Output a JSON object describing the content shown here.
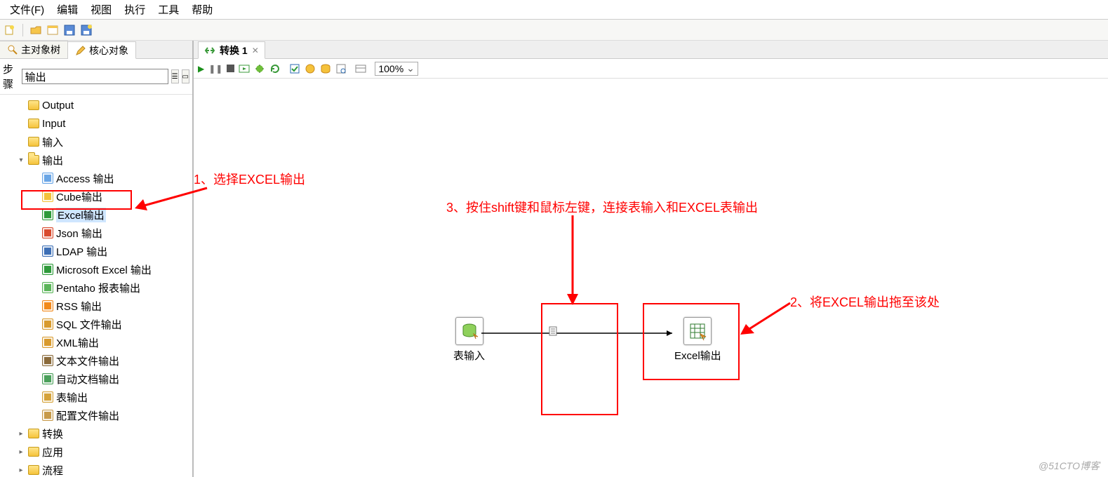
{
  "menu": {
    "file": "文件(F)",
    "edit": "编辑",
    "view": "视图",
    "run": "执行",
    "tools": "工具",
    "help": "帮助"
  },
  "sidebar": {
    "tab_main": "主对象树",
    "tab_core": "核心对象",
    "search_label": "步骤",
    "search_value": "输出",
    "items": [
      {
        "label": "Output",
        "level": 1,
        "type": "folder"
      },
      {
        "label": "Input",
        "level": 1,
        "type": "folder"
      },
      {
        "label": "输入",
        "level": 1,
        "type": "folder"
      },
      {
        "label": "输出",
        "level": 1,
        "type": "folder",
        "expanded": true
      },
      {
        "label": "Access 输出",
        "level": 2,
        "type": "step",
        "color": "#6aa6e6"
      },
      {
        "label": "Cube输出",
        "level": 2,
        "type": "step",
        "color": "#f3c23b"
      },
      {
        "label": "Excel输出",
        "level": 2,
        "type": "step",
        "selected": true,
        "color": "#2e9a3a"
      },
      {
        "label": "Json 输出",
        "level": 2,
        "type": "step",
        "color": "#d94b2f"
      },
      {
        "label": "LDAP 输出",
        "level": 2,
        "type": "step",
        "color": "#3d6fb5"
      },
      {
        "label": "Microsoft Excel 输出",
        "level": 2,
        "type": "step",
        "color": "#2e9a3a"
      },
      {
        "label": "Pentaho 报表输出",
        "level": 2,
        "type": "step",
        "color": "#5bb559"
      },
      {
        "label": "RSS 输出",
        "level": 2,
        "type": "step",
        "color": "#f28a1c"
      },
      {
        "label": "SQL 文件输出",
        "level": 2,
        "type": "step",
        "color": "#d89a2e"
      },
      {
        "label": "XML输出",
        "level": 2,
        "type": "step",
        "color": "#d89a2e"
      },
      {
        "label": "文本文件输出",
        "level": 2,
        "type": "step",
        "color": "#8a6a3a"
      },
      {
        "label": "自动文档输出",
        "level": 2,
        "type": "step",
        "color": "#4aa05a"
      },
      {
        "label": "表输出",
        "level": 2,
        "type": "step",
        "color": "#d5a23a"
      },
      {
        "label": "配置文件输出",
        "level": 2,
        "type": "step",
        "color": "#c79a4a"
      },
      {
        "label": "转换",
        "level": 1,
        "type": "folder"
      },
      {
        "label": "应用",
        "level": 1,
        "type": "folder"
      },
      {
        "label": "流程",
        "level": 1,
        "type": "folder"
      }
    ]
  },
  "canvas": {
    "tab_title": "转换 1",
    "zoom": "100%",
    "node_input": "表输入",
    "node_output": "Excel输出"
  },
  "annotations": {
    "a1": "1、选择EXCEL输出",
    "a2": "2、将EXCEL输出拖至该处",
    "a3": "3、按住shift键和鼠标左键，连接表输入和EXCEL表输出"
  },
  "watermark": "@51CTO博客"
}
